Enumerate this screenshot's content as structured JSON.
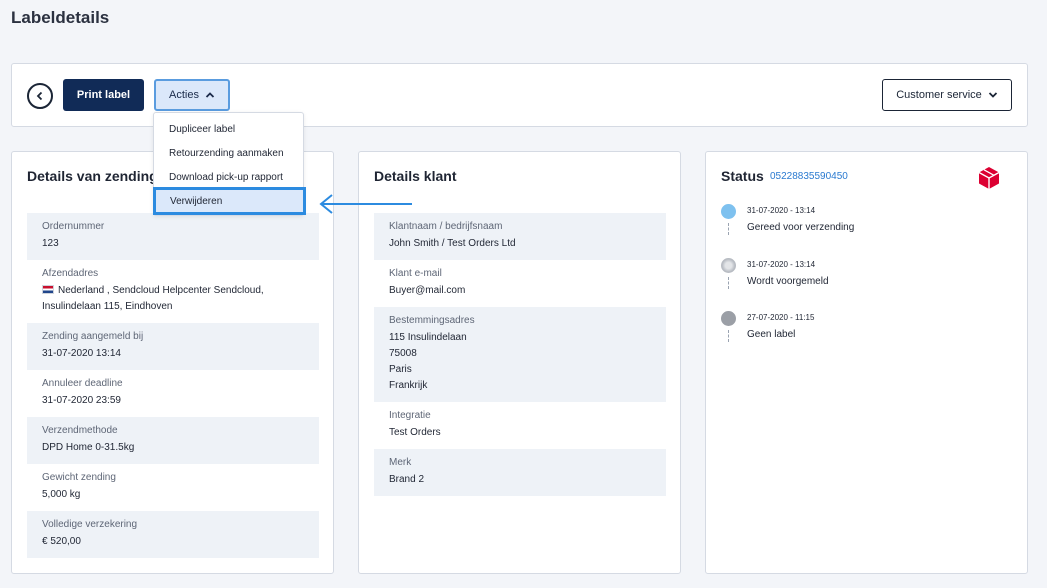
{
  "page": {
    "title": "Labeldetails"
  },
  "toolbar": {
    "print_label": "Print label",
    "acties_label": "Acties",
    "customer_service_label": "Customer service"
  },
  "dropdown": {
    "items": [
      {
        "label": "Dupliceer label"
      },
      {
        "label": "Retourzending aanmaken"
      },
      {
        "label": "Download pick-up rapport"
      },
      {
        "label": "Verwijderen"
      }
    ]
  },
  "shipment": {
    "title": "Details van zending",
    "rows": [
      {
        "label": "Ordernummer",
        "value": "123"
      },
      {
        "label": "Afzendadres",
        "value_line1": "Nederland , Sendcloud Helpcenter Sendcloud,",
        "value_line2": "Insulindelaan 115, Eindhoven"
      },
      {
        "label": "Zending aangemeld bij",
        "value": "31-07-2020 13:14"
      },
      {
        "label": "Annuleer deadline",
        "value": "31-07-2020 23:59"
      },
      {
        "label": "Verzendmethode",
        "value": "DPD Home 0-31.5kg"
      },
      {
        "label": "Gewicht zending",
        "value": "5,000 kg"
      },
      {
        "label": "Volledige verzekering",
        "value": "€ 520,00"
      }
    ]
  },
  "customer": {
    "title": "Details klant",
    "rows": [
      {
        "label": "Klantnaam / bedrijfsnaam",
        "value": "John Smith / Test Orders Ltd"
      },
      {
        "label": "Klant e-mail",
        "value": "Buyer@mail.com"
      },
      {
        "label": "Bestemmingsadres",
        "lines": [
          "115 Insulindelaan",
          "75008",
          "Paris",
          "Frankrijk"
        ]
      },
      {
        "label": "Integratie",
        "value": "Test Orders"
      },
      {
        "label": "Merk",
        "value": "Brand 2"
      }
    ]
  },
  "status": {
    "title": "Status",
    "tracking_number": "05228835590450",
    "events": [
      {
        "time": "31-07-2020 - 13:14",
        "text": "Gereed voor verzending",
        "color": "#7ec1ef"
      },
      {
        "time": "31-07-2020 - 13:14",
        "text": "Wordt voorgemeld",
        "color": "#b8bcc3"
      },
      {
        "time": "27-07-2020 - 11:15",
        "text": "Geen label",
        "color": "#9b9fa6"
      }
    ]
  },
  "colors": {
    "primary": "#112b57",
    "accent": "#2c8be0",
    "carrier": "#dc0032"
  }
}
